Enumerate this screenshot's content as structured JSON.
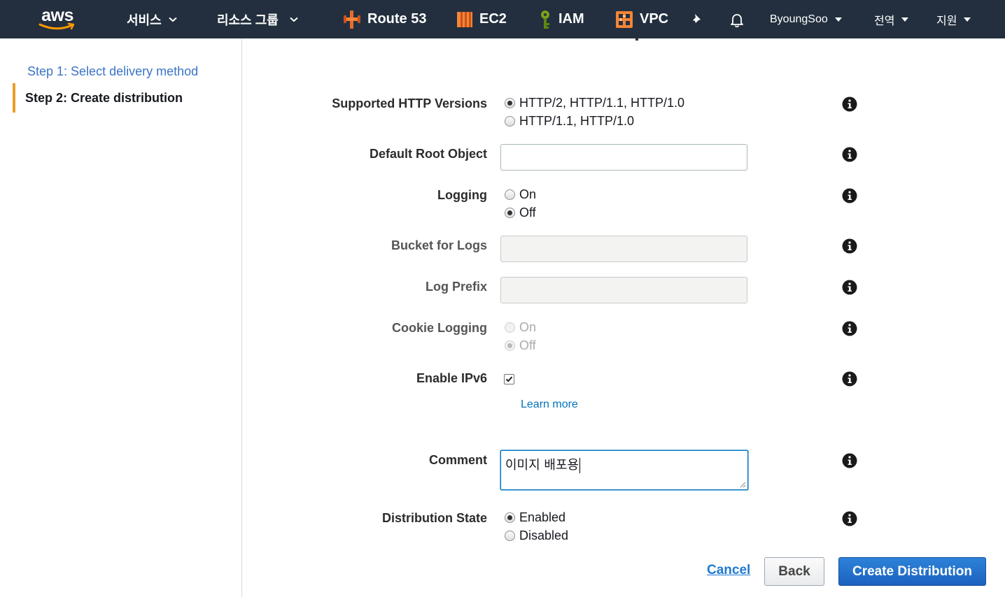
{
  "nav": {
    "logo_text": "aws",
    "services_label": "서비스",
    "resource_groups_label": "리소스 그룹",
    "shortcuts": [
      {
        "label": "Route 53",
        "icon": "route53-icon"
      },
      {
        "label": "EC2",
        "icon": "ec2-icon"
      },
      {
        "label": "IAM",
        "icon": "iam-icon"
      },
      {
        "label": "VPC",
        "icon": "vpc-icon"
      }
    ],
    "user_label": "ByoungSoo",
    "region_label": "전역",
    "support_label": "지원"
  },
  "sidebar": {
    "steps": [
      {
        "label": "Step 1: Select delivery method",
        "active": false
      },
      {
        "label": "Step 2: Create distribution",
        "active": true
      }
    ]
  },
  "form": {
    "http_versions": {
      "label": "Supported HTTP Versions",
      "options": [
        "HTTP/2, HTTP/1.1, HTTP/1.0",
        "HTTP/1.1, HTTP/1.0"
      ],
      "selected": "HTTP/2, HTTP/1.1, HTTP/1.0"
    },
    "default_root_object": {
      "label": "Default Root Object",
      "value": ""
    },
    "logging": {
      "label": "Logging",
      "options": [
        "On",
        "Off"
      ],
      "selected": "Off"
    },
    "bucket_for_logs": {
      "label": "Bucket for Logs",
      "value": "",
      "disabled": true
    },
    "log_prefix": {
      "label": "Log Prefix",
      "value": "",
      "disabled": true
    },
    "cookie_logging": {
      "label": "Cookie Logging",
      "options": [
        "On",
        "Off"
      ],
      "selected": "Off",
      "disabled": true
    },
    "enable_ipv6": {
      "label": "Enable IPv6",
      "checked": true,
      "learn_more": "Learn more"
    },
    "comment": {
      "label": "Comment",
      "value": "이미지 배포용"
    },
    "distribution_state": {
      "label": "Distribution State",
      "options": [
        "Enabled",
        "Disabled"
      ],
      "selected": "Enabled"
    }
  },
  "buttons": {
    "cancel": "Cancel",
    "back": "Back",
    "create": "Create Distribution"
  },
  "colors": {
    "nav_bg": "#232f3e",
    "link": "#0073bb",
    "primary": "#1b62bf",
    "active_step_bar": "#ec9d2a"
  }
}
